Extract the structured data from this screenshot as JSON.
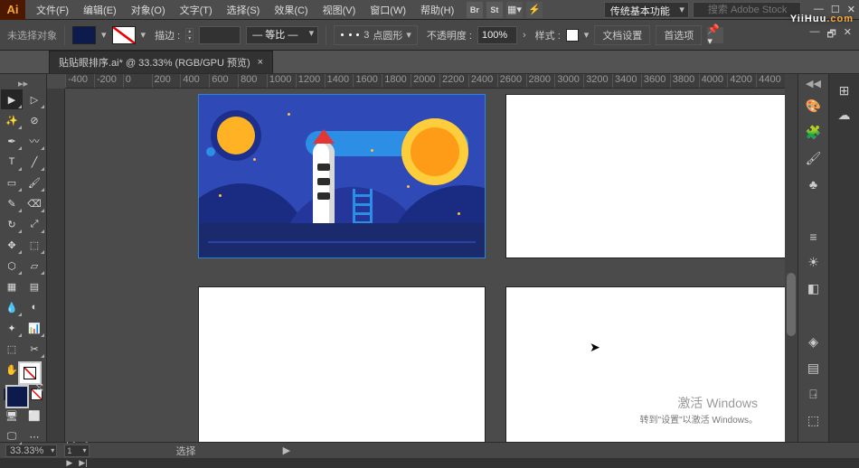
{
  "app": {
    "logo": "Ai"
  },
  "menubar": [
    "文件(F)",
    "编辑(E)",
    "对象(O)",
    "文字(T)",
    "选择(S)",
    "效果(C)",
    "视图(V)",
    "窗口(W)",
    "帮助(H)"
  ],
  "titlebar_badges": [
    "Br",
    "St"
  ],
  "workspace": "传统基本功能",
  "search_placeholder": "搜索 Adobe Stock",
  "options": {
    "no_selection": "未选择对象",
    "stroke_label": "描边 :",
    "stroke_weight": "",
    "dash_value": "3",
    "dash_profile": "点圆形",
    "opacity_label": "不透明度 :",
    "opacity_value": "100%",
    "style_label": "样式 :",
    "doc_setup": "文档设置",
    "prefs": "首选项"
  },
  "document_tab": {
    "label": "贴贴眼排序.ai* @ 33.33% (RGB/GPU 预览)",
    "close": "×"
  },
  "ruler_marks": [
    "-400",
    "-200",
    "0",
    "200",
    "400",
    "600",
    "800",
    "1000",
    "1200",
    "1400",
    "1600",
    "1800",
    "2000",
    "2200",
    "2400",
    "2600",
    "2800",
    "3000",
    "3200",
    "3400",
    "3600",
    "3800",
    "4000",
    "4200",
    "4400"
  ],
  "status": {
    "zoom": "33.33%",
    "nav": [
      "|◀",
      "◀",
      "1",
      "▶",
      "▶|"
    ],
    "select_label": "选择",
    "tri": "▶"
  },
  "right_panel_icons": [
    "palette",
    "brush",
    "swatch",
    "stroke",
    "appearance",
    "sun",
    "align",
    "layers",
    "artboards",
    "doc"
  ],
  "activate": {
    "line1": "激活 Windows",
    "line2": "转到\"设置\"以激活 Windows。"
  },
  "watermark": {
    "text": "YiiHuu",
    "dotcom": ".com"
  },
  "colors": {
    "fill": "#0d1b4c",
    "accent": "#2a84d2",
    "ai_brand": "#f7a638"
  }
}
